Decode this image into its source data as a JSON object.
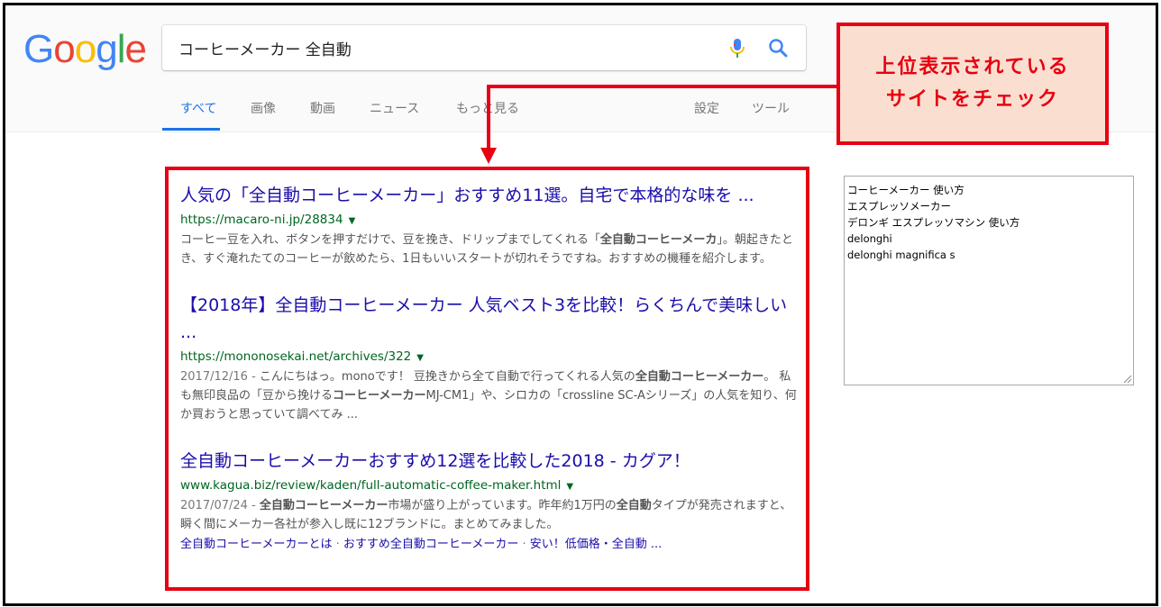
{
  "logo": {
    "letters": [
      "G",
      "o",
      "o",
      "g",
      "l",
      "e"
    ],
    "colors": [
      "#4285f4",
      "#ea4335",
      "#fbbc05",
      "#4285f4",
      "#34a853",
      "#ea4335"
    ]
  },
  "search": {
    "query": "コーヒーメーカー 全自動"
  },
  "tabs": [
    "すべて",
    "画像",
    "動画",
    "ニュース",
    "もっと見る"
  ],
  "tools": [
    "設定",
    "ツール"
  ],
  "results": [
    {
      "title": "人気の「全自動コーヒーメーカー」おすすめ11選。自宅で本格的な味を ...",
      "url": "https://macaro-ni.jp/28834",
      "snippet_parts": [
        {
          "t": "コーヒー豆を入れ、ボタンを押すだけで、豆を挽き、ドリップまでしてくれる「",
          "b": false
        },
        {
          "t": "全自動コーヒーメーカ",
          "b": true
        },
        {
          "t": "」。朝起きたとき、すぐ淹れたてのコーヒーが飲めたら、1日もいいスタートが切れそうですね。おすすめの機種を紹介します。",
          "b": false
        }
      ]
    },
    {
      "title": "【2018年】全自動コーヒーメーカー 人気ベスト3を比較！らくちんで美味しい ...",
      "url": "https://mononosekai.net/archives/322",
      "date": "2017/12/16",
      "snippet_parts": [
        {
          "t": "こんにちはっ。monoです！ 豆挽きから全て自動で行ってくれる人気の",
          "b": false
        },
        {
          "t": "全自動コーヒーメーカー",
          "b": true
        },
        {
          "t": "。 私も無印良品の「豆から挽ける",
          "b": false
        },
        {
          "t": "コーヒーメーカー",
          "b": true
        },
        {
          "t": "MJ-CM1」や、シロカの「crossline SC-Aシリーズ」の人気を知り、何か買おうと思っていて調べてみ ...",
          "b": false
        }
      ]
    },
    {
      "title": "全自動コーヒーメーカーおすすめ12選を比較した2018 - カグア！",
      "url": "www.kagua.biz/review/kaden/full-automatic-coffee-maker.html",
      "date": "2017/07/24",
      "snippet_parts": [
        {
          "t": "全自動コーヒーメーカー",
          "b": true
        },
        {
          "t": "市場が盛り上がっています。昨年約1万円の",
          "b": false
        },
        {
          "t": "全自動",
          "b": true
        },
        {
          "t": "タイプが発売されますと、瞬く間にメーカー各社が参入し既に12ブランドに。まとめてみました。",
          "b": false
        }
      ],
      "sitelinks": [
        "全自動コーヒーメーカーとは",
        "おすすめ全自動コーヒーメーカー",
        "安い！低価格・全自動 ..."
      ]
    }
  ],
  "callout": {
    "line1": "上位表示されている",
    "line2": "サイトをチェック",
    "color": "#e60012"
  },
  "related": [
    "コーヒーメーカー 使い方",
    "エスプレッソメーカー",
    "デロンギ エスプレッソマシン 使い方",
    "delonghi",
    "delonghi magnifica s"
  ]
}
